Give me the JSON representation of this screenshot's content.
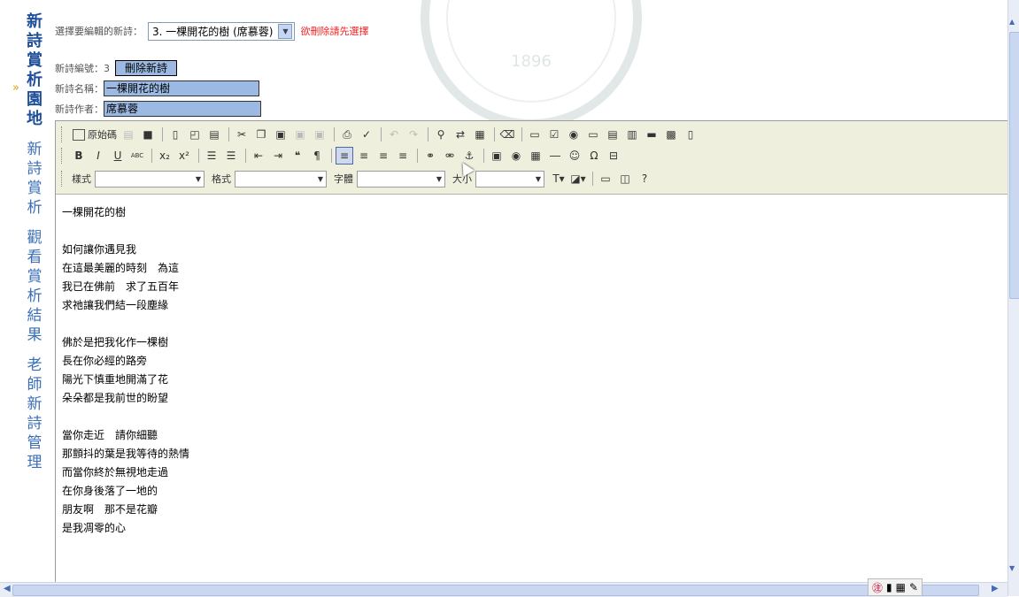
{
  "nav": [
    {
      "chars": [
        "新",
        "詩",
        "賞",
        "析",
        "園",
        "地"
      ],
      "active": true
    },
    {
      "chars": [
        "新",
        "詩",
        "賞",
        "析"
      ],
      "active": false
    },
    {
      "chars": [
        "觀",
        "看",
        "賞",
        "析",
        "結",
        "果"
      ],
      "active": false
    },
    {
      "chars": [
        "老",
        "師",
        "新",
        "詩",
        "管",
        "理"
      ],
      "active": false
    }
  ],
  "form": {
    "select_label": "選擇要編輯的新詩：",
    "select_value": "3. 一棵開花的樹 (席慕蓉)",
    "delete_hint": "欲刪除請先選擇",
    "id_label": "新詩編號：",
    "id_value": "3",
    "delete_button": "刪除新詩",
    "name_label": "新詩名稱：",
    "name_value": "一棵開花的樹",
    "author_label": "新詩作者：",
    "author_value": "席慕蓉"
  },
  "seal_text": "1896",
  "toolbar": {
    "source_label": "原始碼",
    "style_label": "樣式",
    "format_label": "格式",
    "font_label": "字體",
    "size_label": "大小",
    "row1_icons": [
      "cut-icon",
      "save-icon",
      "new-page-icon",
      "preview-icon",
      "templates-icon",
      "scissors-icon",
      "copy-icon",
      "paste-icon",
      "paste-text-icon",
      "paste-word-icon",
      "print-icon",
      "spellcheck-icon",
      "undo-icon",
      "redo-icon",
      "find-icon",
      "replace-icon",
      "select-all-icon",
      "remove-format-icon",
      "form-icon",
      "checkbox-icon",
      "radio-icon",
      "textfield-icon",
      "textarea-icon",
      "select-field-icon",
      "button-icon",
      "image-button-icon",
      "hidden-field-icon"
    ],
    "row2": [
      {
        "name": "bold-icon",
        "glyph": "B"
      },
      {
        "name": "italic-icon",
        "glyph": "I"
      },
      {
        "name": "underline-icon",
        "glyph": "U"
      },
      {
        "name": "strike-icon",
        "glyph": "ABC"
      },
      {
        "name": "subscript-icon",
        "glyph": "x₂"
      },
      {
        "name": "superscript-icon",
        "glyph": "x²"
      },
      {
        "name": "ordered-list-icon",
        "glyph": "☰"
      },
      {
        "name": "bullet-list-icon",
        "glyph": "☰"
      },
      {
        "name": "outdent-icon",
        "glyph": "⇤"
      },
      {
        "name": "indent-icon",
        "glyph": "⇥"
      },
      {
        "name": "blockquote-icon",
        "glyph": "❝"
      },
      {
        "name": "div-icon",
        "glyph": "¶"
      },
      {
        "name": "align-left-icon",
        "glyph": "≡"
      },
      {
        "name": "align-center-icon",
        "glyph": "≡"
      },
      {
        "name": "align-right-icon",
        "glyph": "≡"
      },
      {
        "name": "justify-icon",
        "glyph": "≡"
      },
      {
        "name": "link-icon",
        "glyph": "⚭"
      },
      {
        "name": "unlink-icon",
        "glyph": "⚮"
      },
      {
        "name": "anchor-icon",
        "glyph": "⚓"
      },
      {
        "name": "image-icon",
        "glyph": "▣"
      },
      {
        "name": "flash-icon",
        "glyph": "◉"
      },
      {
        "name": "table-icon",
        "glyph": "▦"
      },
      {
        "name": "hr-icon",
        "glyph": "―"
      },
      {
        "name": "smiley-icon",
        "glyph": "☺"
      },
      {
        "name": "special-char-icon",
        "glyph": "Ω"
      },
      {
        "name": "page-break-icon",
        "glyph": "⊟"
      }
    ]
  },
  "poem": [
    "一棵開花的樹",
    "",
    "如何讓你遇見我",
    "在這最美麗的時刻　為這",
    "我已在佛前　求了五百年",
    "求祂讓我們結一段塵緣",
    "",
    "佛於是把我化作一棵樹",
    "長在你必經的路旁",
    "陽光下慎重地開滿了花",
    "朵朵都是我前世的盼望",
    "",
    "當你走近　請你細聽",
    "那顫抖的葉是我等待的熱情",
    "而當你終於無視地走過",
    "在你身後落了一地的",
    "朋友啊　那不是花瓣",
    "是我凋零的心"
  ],
  "ime_glyph": "㊟"
}
